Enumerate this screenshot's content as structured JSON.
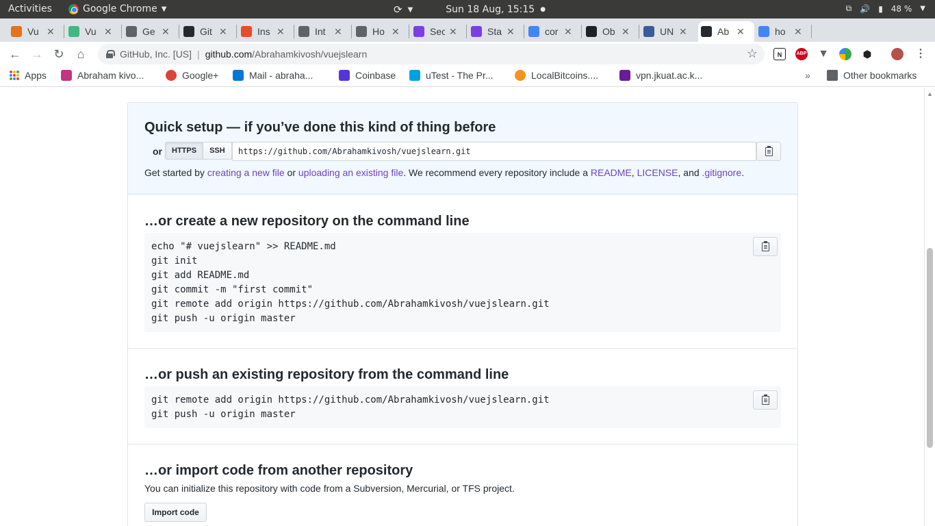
{
  "os_bar": {
    "activities": "Activities",
    "app_name": "Google Chrome",
    "clock": "Sun 18 Aug, 15:15",
    "battery": "48 %"
  },
  "tabs": [
    {
      "label": "Vu",
      "color": "#e8711c"
    },
    {
      "label": "Vu",
      "color": "#41b883"
    },
    {
      "label": "Ge",
      "color": "#5f6368"
    },
    {
      "label": "Git",
      "color": "#24292e"
    },
    {
      "label": "Ins",
      "color": "#e34f26"
    },
    {
      "label": "Int",
      "color": "#5f6368"
    },
    {
      "label": "Ho",
      "color": "#5f6368"
    },
    {
      "label": "Sec",
      "color": "#7b3fe4"
    },
    {
      "label": "Sta",
      "color": "#7b3fe4"
    },
    {
      "label": "cor",
      "color": "#4285f4"
    },
    {
      "label": "Ob",
      "color": "#202124"
    },
    {
      "label": "UN",
      "color": "#3a5a9a"
    },
    {
      "label": "Ab",
      "color": "#24292e"
    },
    {
      "label": "ho",
      "color": "#4285f4"
    }
  ],
  "omnibox": {
    "org": "GitHub, Inc. [US]",
    "host": "github.com",
    "path": "/Abrahamkivosh/vuejslearn"
  },
  "bookmarks": [
    {
      "label": "Apps",
      "color": "#4285f4"
    },
    {
      "label": "Abraham kivo...",
      "color": "#c13584"
    },
    {
      "label": "Google+",
      "color": "#db4437"
    },
    {
      "label": "Mail - abraha...",
      "color": "#0078d4"
    },
    {
      "label": "Coinbase",
      "color": "#5436d6"
    },
    {
      "label": "uTest - The Pr...",
      "color": "#00a1e0"
    },
    {
      "label": "LocalBitcoins....",
      "color": "#f7931a"
    },
    {
      "label": "vpn.jkuat.ac.k...",
      "color": "#6a1b9a"
    }
  ],
  "other_bookmarks": "Other bookmarks",
  "quick_setup": {
    "title": "Quick setup — if you’ve done this kind of thing before",
    "or": "or",
    "https": "HTTPS",
    "ssh": "SSH",
    "url": "https://github.com/Abrahamkivosh/vuejslearn.git",
    "lede_1": "Get started by ",
    "link_new_file": "creating a new file",
    "lede_2": " or ",
    "link_upload": "uploading an existing file",
    "lede_3": ". We recommend every repository include a ",
    "link_readme": "README",
    "lede_4": ", ",
    "link_license": "LICENSE",
    "lede_5": ", and ",
    "link_gitignore": ".gitignore",
    "lede_6": "."
  },
  "new_repo": {
    "title": "…or create a new repository on the command line",
    "code": "echo \"# vuejslearn\" >> README.md\ngit init\ngit add README.md\ngit commit -m \"first commit\"\ngit remote add origin https://github.com/Abrahamkivosh/vuejslearn.git\ngit push -u origin master"
  },
  "push_existing": {
    "title": "…or push an existing repository from the command line",
    "code": "git remote add origin https://github.com/Abrahamkivosh/vuejslearn.git\ngit push -u origin master"
  },
  "import": {
    "title": "…or import code from another repository",
    "desc": "You can initialize this repository with code from a Subversion, Mercurial, or TFS project.",
    "button": "Import code"
  }
}
